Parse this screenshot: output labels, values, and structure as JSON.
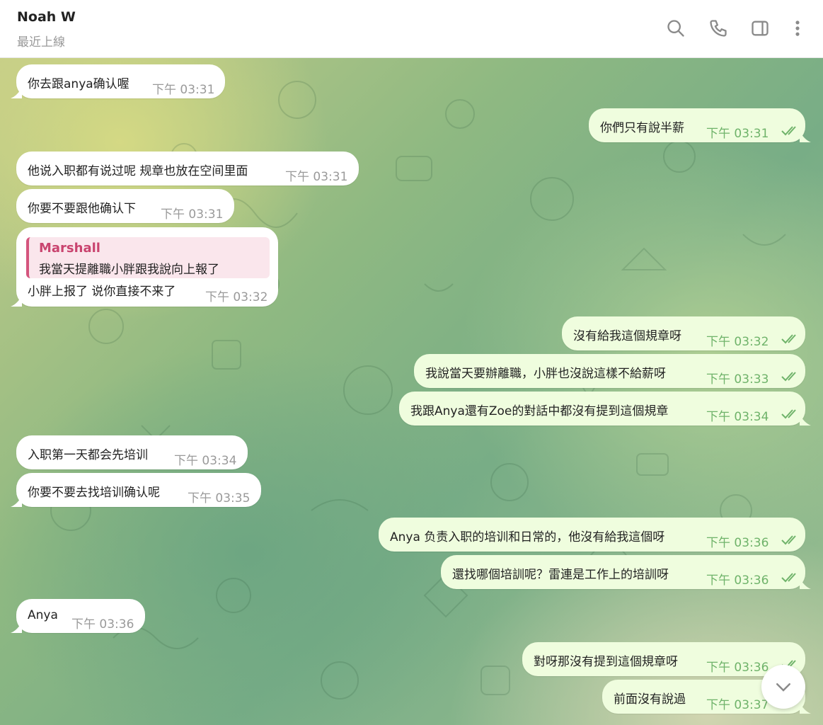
{
  "header": {
    "name": "Noah W",
    "status": "最近上線",
    "icons": [
      "search-icon",
      "phone-icon",
      "sidebar-toggle-icon",
      "more-vertical-icon"
    ]
  },
  "messages": [
    {
      "dir": "in",
      "text": "你去跟anya确认喔",
      "time": "下午 03:31"
    },
    {
      "dir": "out",
      "text": "你們只有說半薪",
      "time": "下午 03:31"
    },
    {
      "dir": "in",
      "text": "他说入职都有说过呢 规章也放在空间里面",
      "time": "下午 03:31"
    },
    {
      "dir": "in",
      "text": "你要不要跟他确认下",
      "time": "下午 03:31"
    },
    {
      "dir": "in",
      "reply_to": {
        "name": "Marshall",
        "text": "我當天提離職小胖跟我說向上報了"
      },
      "text": "小胖上报了 说你直接不来了",
      "time": "下午 03:32"
    },
    {
      "dir": "out",
      "text": "沒有給我這個規章呀",
      "time": "下午 03:32"
    },
    {
      "dir": "out",
      "text": "我說當天要辦離職，小胖也沒說這樣不給薪呀",
      "time": "下午 03:33"
    },
    {
      "dir": "out",
      "text": "我跟Anya還有Zoe的對話中都沒有提到這個規章",
      "time": "下午 03:34"
    },
    {
      "dir": "in",
      "text": "入职第一天都会先培训",
      "time": "下午 03:34"
    },
    {
      "dir": "in",
      "text": "你要不要去找培训确认呢",
      "time": "下午 03:35"
    },
    {
      "dir": "out",
      "text": "Anya 负责入职的培训和日常的，他沒有給我這個呀",
      "time": "下午 03:36"
    },
    {
      "dir": "out",
      "text": "還找哪個培訓呢？雷連是工作上的培訓呀",
      "time": "下午 03:36"
    },
    {
      "dir": "in",
      "text": "Anya",
      "time": "下午 03:36"
    },
    {
      "dir": "out",
      "text": "對呀那沒有提到這個規章呀",
      "time": "下午 03:36"
    },
    {
      "dir": "out",
      "text": "前面沒有說過",
      "time": "下午 03:37"
    }
  ],
  "colors": {
    "incoming": "#ffffff",
    "outgoing": "#effdde",
    "outgoing_time": "#6fb36a",
    "reply_accent": "#c9446f"
  },
  "scroll_button": "chevron-down-icon"
}
